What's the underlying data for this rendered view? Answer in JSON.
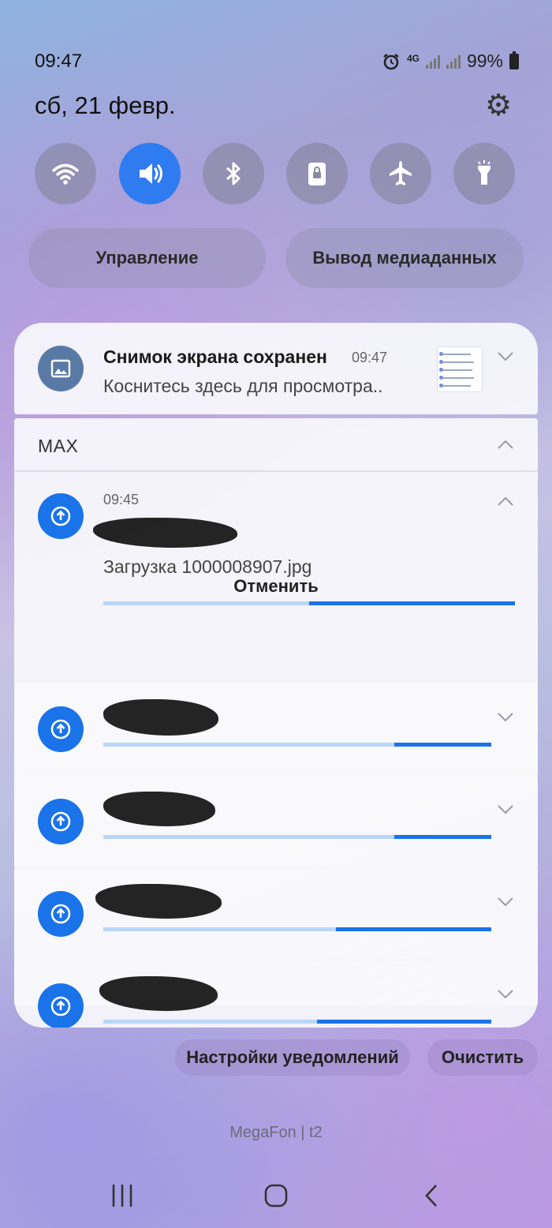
{
  "status": {
    "time": "09:47",
    "network": "4G",
    "battery": "99%",
    "icons": [
      "alarm-icon",
      "4g-icon",
      "signal-icon",
      "signal-icon",
      "battery-icon"
    ]
  },
  "date": "сб, 21 февр.",
  "quick_settings": {
    "tiles": [
      {
        "name": "wifi",
        "icon": "wifi-icon",
        "active": false
      },
      {
        "name": "sound",
        "icon": "volume-icon",
        "active": true
      },
      {
        "name": "bluetooth",
        "icon": "bluetooth-icon",
        "active": false
      },
      {
        "name": "rotation-lock",
        "icon": "lock-icon",
        "active": false
      },
      {
        "name": "airplane-mode",
        "icon": "airplane-icon",
        "active": false
      },
      {
        "name": "flashlight",
        "icon": "flashlight-icon",
        "active": false
      }
    ],
    "buttons": {
      "control": "Управление",
      "media_output": "Вывод медиаданных"
    }
  },
  "notifications": {
    "screenshot": {
      "title": "Снимок экрана сохранен",
      "time": "09:47",
      "body": "Коснитесь здесь для просмотра.."
    },
    "max": {
      "app_name": "MAX",
      "expanded": {
        "time": "09:45",
        "body": "Загрузка 1000008907.jpg",
        "progress": 0.5,
        "cancel_label": "Отменить"
      },
      "uploads": [
        {
          "progress": 0.75
        },
        {
          "progress": 0.75
        },
        {
          "progress": 0.6
        },
        {
          "progress": 0.55
        }
      ]
    }
  },
  "bottom": {
    "settings_label": "Настройки уведомлений",
    "clear_label": "Очистить",
    "carrier": "MegaFon | t2"
  },
  "colors": {
    "accent": "#1a73e8",
    "progress_track": "#b9d6f7",
    "active_tile": "#2f7cf0"
  }
}
